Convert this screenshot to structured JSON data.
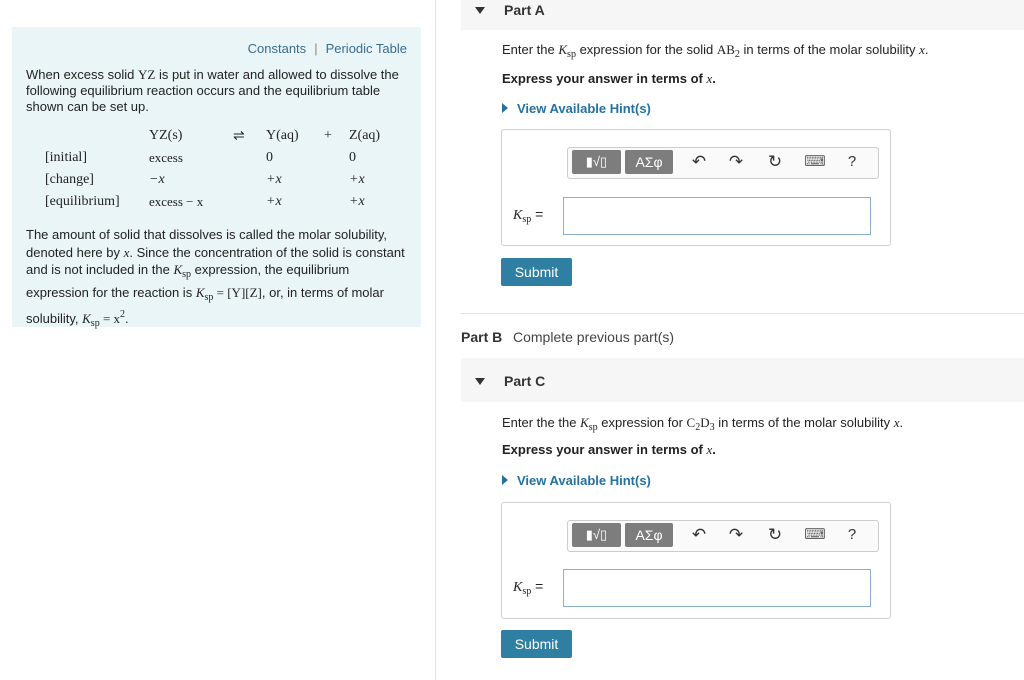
{
  "left": {
    "links": [
      "Constants",
      "Periodic Table"
    ],
    "link_separator": "|",
    "intro_pre": "When excess solid ",
    "intro_species": "YZ",
    "intro_post": " is put in water and allowed to dissolve the following equilibrium reaction occurs and the equilibrium table shown can be set up.",
    "table": {
      "reactant": "YZ(s)",
      "arrow": "⇌",
      "product1": "Y(aq)",
      "plus": "+",
      "product2": "Z(aq)",
      "rows": [
        {
          "label": "[initial]",
          "reactant": "excess",
          "p1": "0",
          "p2": "0"
        },
        {
          "label": "[change]",
          "reactant": "−x",
          "p1": "+x",
          "p2": "+x"
        },
        {
          "label": "[equilibrium]",
          "reactant": "excess − x",
          "p1": "+x",
          "p2": "+x"
        }
      ]
    },
    "explain1": "The amount of solid that dissolves is called the molar solubility, denoted here by ",
    "explain_var": "x",
    "explain2": ". Since the concentration of the solid is constant and is not included in the ",
    "explain3": " expression, the equilibrium expression for the reaction is ",
    "explain_eq1": " = [Y][Z]",
    "explain4": ", or, in terms of molar solubility, ",
    "explain_eq2": " = x",
    "explain_exp": "2",
    "explain5": "."
  },
  "ksp_K": "K",
  "ksp_sub": "sp",
  "partA": {
    "title": "Part A",
    "prompt_pre": "Enter the ",
    "prompt_mid": " expression for the solid ",
    "formula_main": "AB",
    "formula_sub": "2",
    "prompt_post": " in terms of the molar solubility ",
    "prompt_var": "x",
    "prompt_end": ".",
    "express_pre": "Express your answer in terms of ",
    "express_var": "x",
    "express_end": ".",
    "hint": "View Available Hint(s)",
    "answer_label_eq": " =",
    "answer_value": "",
    "submit": "Submit"
  },
  "partB": {
    "title": "Part B",
    "status": "Complete previous part(s)"
  },
  "partC": {
    "title": "Part C",
    "prompt_pre": "Enter the the ",
    "prompt_mid": " expression for ",
    "formula_a": "C",
    "formula_a_sub": "2",
    "formula_b": "D",
    "formula_b_sub": "3",
    "prompt_post": " in terms of the molar solubility ",
    "prompt_var": "x",
    "prompt_end": ".",
    "express_pre": "Express your answer in terms of ",
    "express_var": "x",
    "express_end": ".",
    "hint": "View Available Hint(s)",
    "answer_label_eq": " =",
    "answer_value": "",
    "submit": "Submit"
  },
  "toolbar": {
    "template_label": "▮√▯",
    "symbols_label": "ΑΣφ",
    "undo": "↶",
    "redo": "↷",
    "reset": "↻",
    "keyboard": "⌨",
    "help": "?"
  }
}
